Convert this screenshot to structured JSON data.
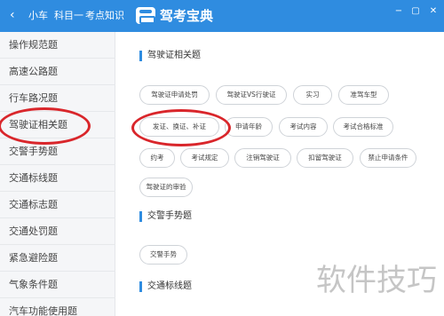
{
  "header": {
    "back_glyph": "‹",
    "crumb_car": "小车",
    "crumb_subject": "科目一",
    "crumb_points": "考点知识",
    "brand": "驾考宝典",
    "accent": "#2f8ce0"
  },
  "window_controls": [
    "−",
    "▢",
    "✕"
  ],
  "sidebar": {
    "items": [
      {
        "label": "操作规范题"
      },
      {
        "label": "高速公路题"
      },
      {
        "label": "行车路况题"
      },
      {
        "label": "驾驶证相关题"
      },
      {
        "label": "交警手势题"
      },
      {
        "label": "交通标线题"
      },
      {
        "label": "交通标志题"
      },
      {
        "label": "交通处罚题"
      },
      {
        "label": "紧急避险题"
      },
      {
        "label": "气象条件题"
      },
      {
        "label": "汽车功能使用题"
      }
    ]
  },
  "sections": [
    {
      "title": "驾驶证相关题",
      "chips": [
        "驾驶证申请处罚",
        "驾驶证VS行驶证",
        "实习",
        "准驾车型",
        "发证、换证、补证",
        "申请年龄",
        "考试内容",
        "考试合格标准",
        "约考",
        "考试规定",
        "注销驾驶证",
        "扣留驾驶证",
        "禁止申请条件",
        "驾驶证的审验"
      ]
    },
    {
      "title": "交警手势题",
      "chips": [
        "交警手势"
      ]
    },
    {
      "title": "交通标线题",
      "chips": []
    }
  ],
  "annotation_color": "#d9262b",
  "watermark": "软件技巧"
}
